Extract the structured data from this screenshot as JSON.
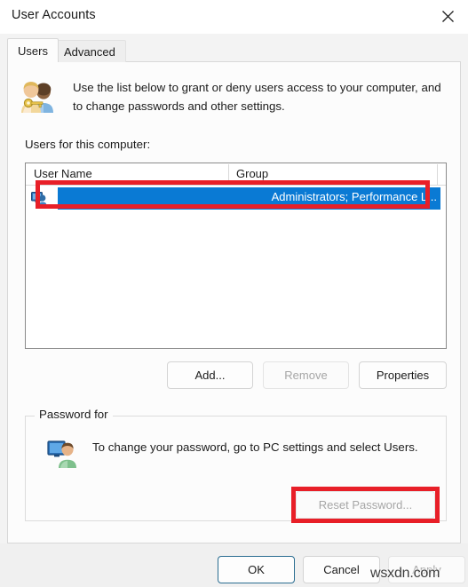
{
  "window": {
    "title": "User Accounts",
    "close_icon": "close-icon"
  },
  "tabs": [
    {
      "label": "Users",
      "active": true
    },
    {
      "label": "Advanced",
      "active": false
    }
  ],
  "users_tab": {
    "header_icon": "users-key-icon",
    "header_text": "Use the list below to grant or deny users access to your computer, and to change passwords and other settings.",
    "list_label": "Users for this computer:",
    "list": {
      "columns": [
        "User Name",
        "Group"
      ],
      "rows": [
        {
          "icon": "user-computer-icon",
          "user_name": "",
          "group": "Administrators; Performance L...",
          "selected": true
        }
      ]
    },
    "buttons": {
      "add": "Add...",
      "remove": "Remove",
      "properties": "Properties"
    },
    "password_group": {
      "legend": "Password for",
      "icon": "user-monitor-icon",
      "text": "To change your password, go to PC settings and select Users.",
      "reset_button": "Reset Password..."
    }
  },
  "footer": {
    "ok": "OK",
    "cancel": "Cancel",
    "apply": "Apply"
  },
  "watermark": "wsxdn.com",
  "annotations": {
    "accent_color": "#e81f28",
    "selection_color": "#0a7ad4"
  }
}
